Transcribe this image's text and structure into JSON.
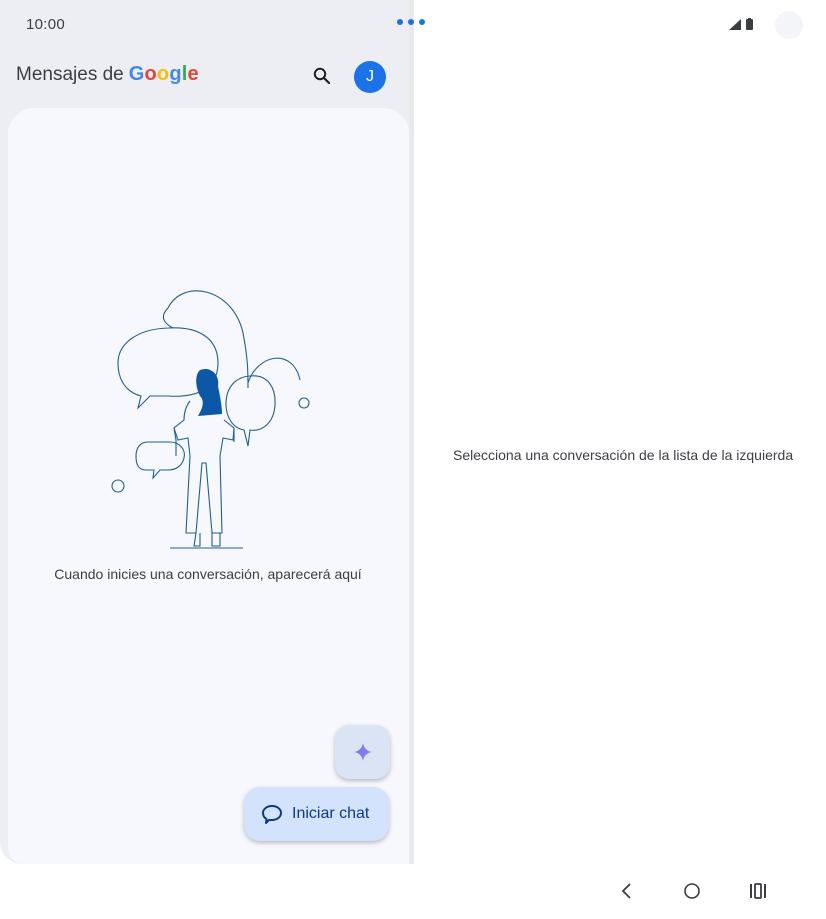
{
  "status_bar": {
    "time": "10:00"
  },
  "header": {
    "app_name_prefix": "Mensajes de",
    "brand_letters": [
      "G",
      "o",
      "o",
      "g",
      "l",
      "e"
    ],
    "avatar_initial": "J"
  },
  "conversation_list": {
    "empty_message": "Cuando inicies una conversación, aparecerá aquí"
  },
  "fab": {
    "start_chat_label": "Iniciar chat"
  },
  "detail_pane": {
    "placeholder": "Selecciona una conversación de la lista de la izquierda"
  },
  "icons": {
    "search": "search-icon",
    "gemini": "sparkle-icon",
    "chat": "chat-bubble-icon",
    "back": "back-icon",
    "home": "home-icon",
    "recents": "recents-icon"
  },
  "colors": {
    "accent": "#1a73e8",
    "fab_background": "#d3e3fd",
    "illustration_stroke": "#1f5f94",
    "illustration_fill": "#0b57a8"
  }
}
